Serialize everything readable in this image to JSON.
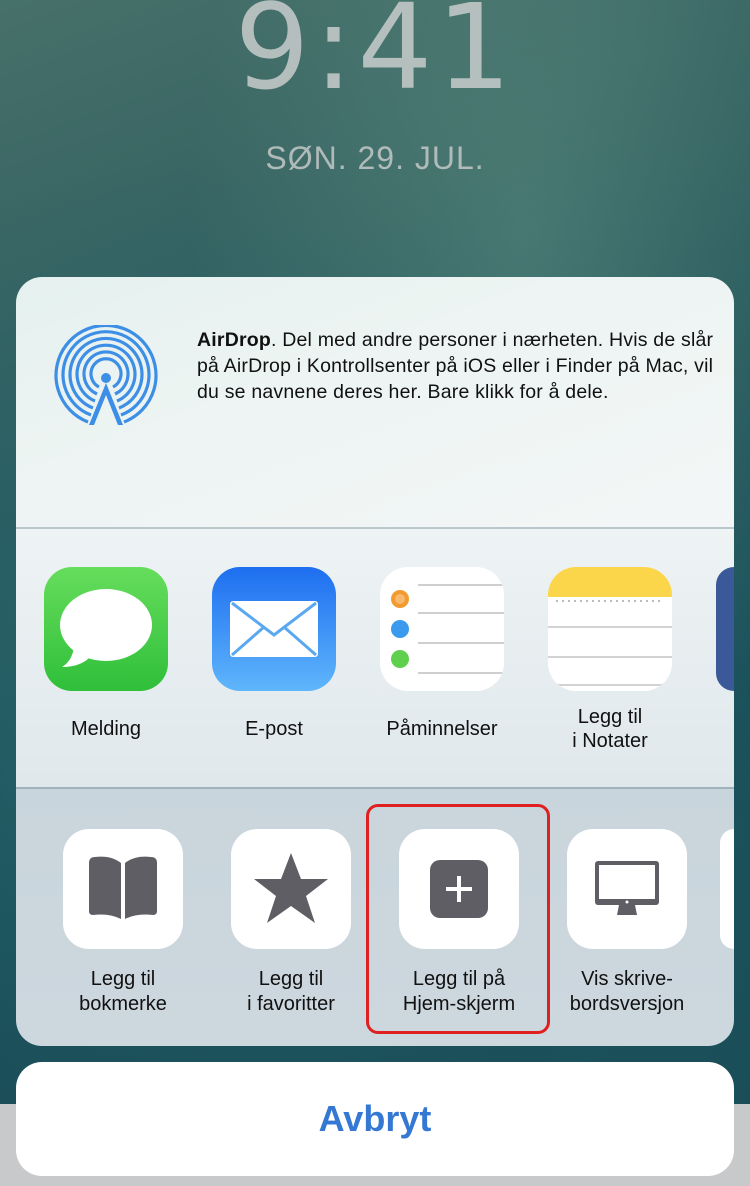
{
  "lockscreen": {
    "time": "9:41",
    "date": "SØN. 29. JUL."
  },
  "airdrop": {
    "title": "AirDrop",
    "description": ". Del med andre personer i nærheten. Hvis de slår på AirDrop i Kontrollsenter på iOS eller i Finder på Mac, vil du se navnene deres her. Bare klikk for å dele.",
    "icon": "airdrop-icon",
    "accent": "#3d8ee6"
  },
  "share_apps": [
    {
      "label": "Melding",
      "icon": "messages-icon"
    },
    {
      "label": "E-post",
      "icon": "mail-icon"
    },
    {
      "label": "Påminnelser",
      "icon": "reminders-icon"
    },
    {
      "label_line1": "Legg til",
      "label_line2": "i Notater",
      "icon": "notes-icon"
    }
  ],
  "actions": [
    {
      "label_line1": "Legg til",
      "label_line2": "bokmerke",
      "icon": "bookmark-book-icon"
    },
    {
      "label_line1": "Legg til",
      "label_line2": "i favoritter",
      "icon": "star-icon"
    },
    {
      "label_line1": "Legg til på",
      "label_line2": "Hjem-skjerm",
      "icon": "add-square-icon",
      "highlighted": true,
      "highlight_color": "#e02020"
    },
    {
      "label_line1": "Vis skrive-",
      "label_line2": "bordsversjon",
      "icon": "desktop-monitor-icon"
    }
  ],
  "cancel": {
    "label": "Avbryt",
    "color": "#3478d4"
  }
}
